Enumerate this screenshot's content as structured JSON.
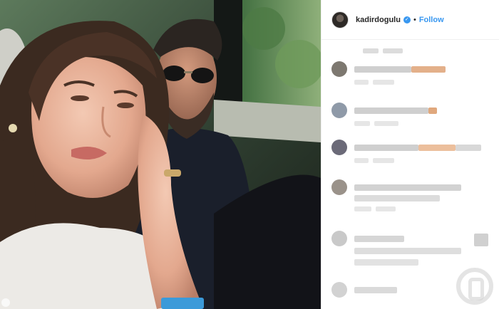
{
  "post": {
    "username": "kadirdogulu",
    "verified_symbol": "✓",
    "separator": "•",
    "follow_label": "Follow"
  },
  "colors": {
    "follow_blue": "#3897f0",
    "verified_blue": "#3897f0",
    "username_text": "#262626",
    "blurred_highlight": "#e8b48c"
  }
}
